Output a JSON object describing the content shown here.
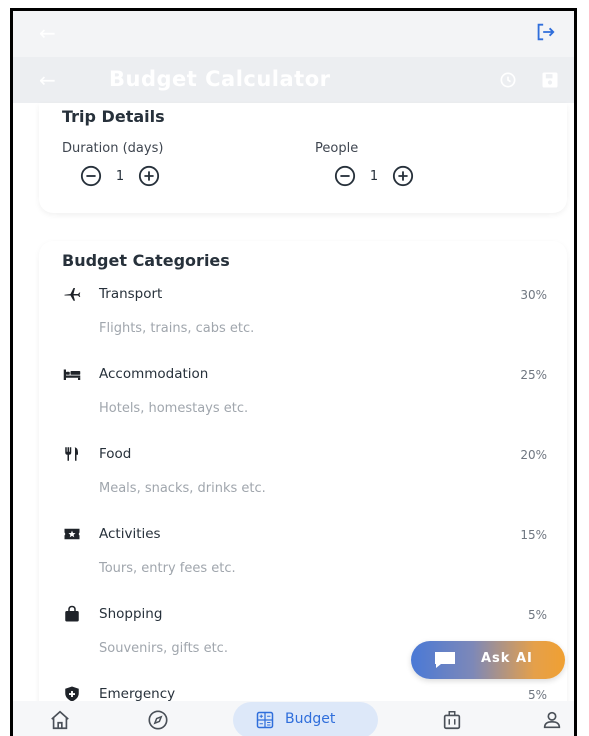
{
  "header": {
    "title": "Budget Calculator"
  },
  "trip_details": {
    "heading": "Trip Details",
    "duration_label": "Duration (days)",
    "duration_value": "1",
    "people_label": "People",
    "people_value": "1"
  },
  "budget_categories": {
    "heading": "Budget Categories",
    "items": [
      {
        "name": "Transport",
        "percent": "30%",
        "description": "Flights, trains, cabs etc.",
        "icon": "airplane-icon"
      },
      {
        "name": "Accommodation",
        "percent": "25%",
        "description": "Hotels, homestays etc.",
        "icon": "bed-icon"
      },
      {
        "name": "Food",
        "percent": "20%",
        "description": "Meals, snacks, drinks etc.",
        "icon": "utensils-icon"
      },
      {
        "name": "Activities",
        "percent": "15%",
        "description": "Tours, entry fees etc.",
        "icon": "ticket-icon"
      },
      {
        "name": "Shopping",
        "percent": "5%",
        "description": "Souvenirs, gifts etc.",
        "icon": "shopping-bag-icon"
      },
      {
        "name": "Emergency",
        "percent": "5%",
        "description": "",
        "icon": "shield-icon"
      }
    ]
  },
  "ask_ai": {
    "label": "Ask AI"
  },
  "bottom_nav": {
    "budget_label": "Budget"
  },
  "colors": {
    "accent": "#2f6edb",
    "text_dark": "#27313b",
    "text_muted": "#a0a6ad"
  }
}
